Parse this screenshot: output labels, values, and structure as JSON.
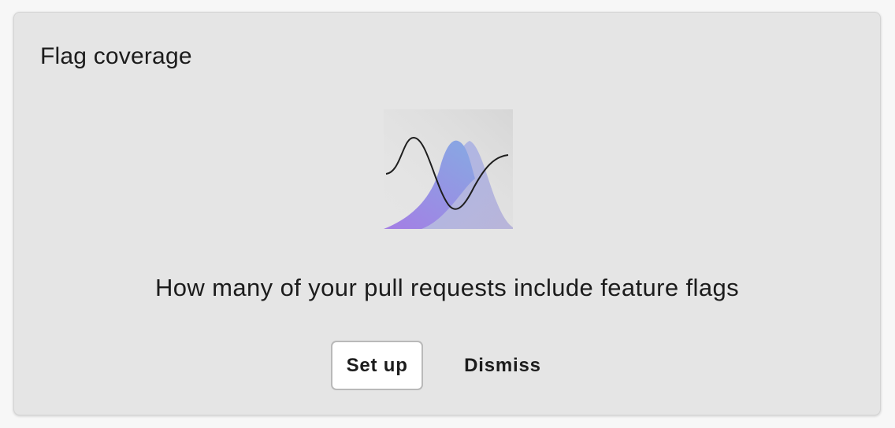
{
  "card": {
    "title": "Flag coverage",
    "illustration_icon": "bell-curve-wave-illustration",
    "description": "How many of your pull requests include feature flags",
    "setup_label": "Set up",
    "dismiss_label": "Dismiss"
  },
  "colors": {
    "card_background": "#e5e5e5",
    "page_background": "#f7f7f7",
    "gradient_purple": "#9b7be3",
    "gradient_blue": "#8aa4e3",
    "button_background": "#ffffff",
    "button_border": "#b9b9b9",
    "text": "#1c1c1c"
  }
}
